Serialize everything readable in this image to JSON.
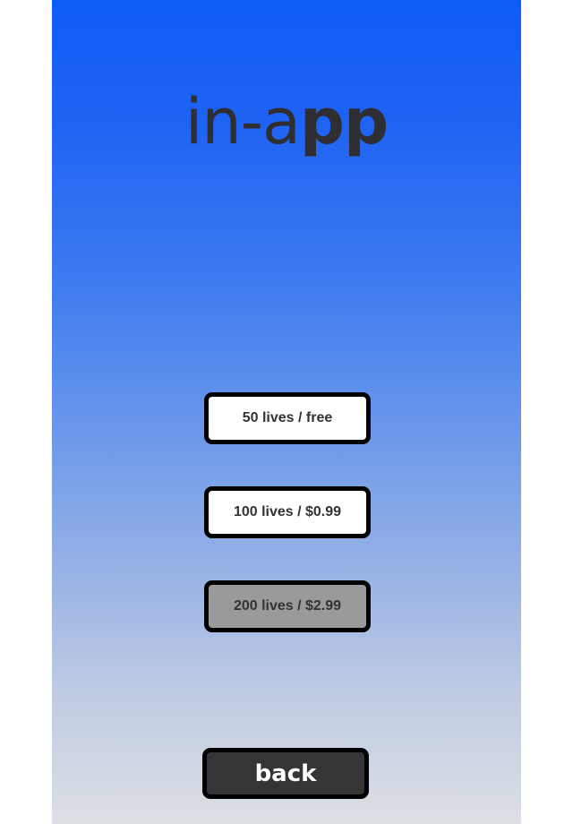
{
  "title": {
    "light": "in-a",
    "bold": "pp"
  },
  "offers": [
    {
      "label": "50 lives / free",
      "enabled": true
    },
    {
      "label": "100 lives / $0.99",
      "enabled": true
    },
    {
      "label": "200 lives / $2.99",
      "enabled": false
    }
  ],
  "back_label": "back",
  "colors": {
    "gradient_top": "#0f5cf6",
    "gradient_bottom": "#dcdfe3",
    "button_bg": "#ffffff",
    "button_disabled_bg": "#9a9a9a",
    "button_border": "#000000",
    "back_bg": "#353538",
    "text_dark": "#333333"
  }
}
